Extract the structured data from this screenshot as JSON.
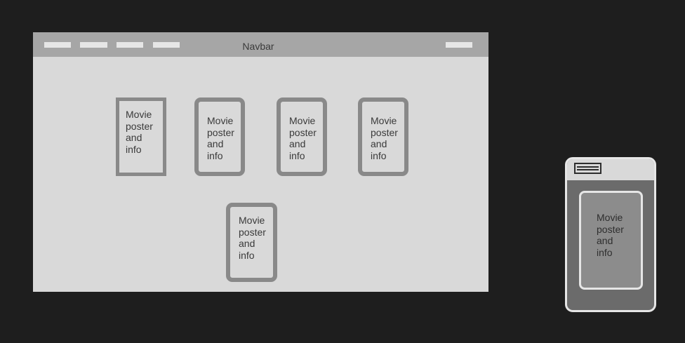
{
  "desktop": {
    "navbar": {
      "title": "Navbar",
      "menu_items": [
        "",
        "",
        "",
        ""
      ],
      "right_item": ""
    },
    "cards": [
      {
        "label": "Movie\nposter\nand\ninfo"
      },
      {
        "label": "Movie\nposter\nand\ninfo"
      },
      {
        "label": "Movie\nposter\nand\ninfo"
      },
      {
        "label": "Movie\nposter\nand\ninfo"
      },
      {
        "label": "Movie\nposter\nand\ninfo"
      }
    ]
  },
  "mobile": {
    "menu_icon": "hamburger-icon",
    "card": {
      "label": "Movie\nposter\nand\ninfo"
    }
  },
  "colors": {
    "canvas": "#1e1e1e",
    "frame": "#d9d9d9",
    "navbar": "#a6a6a6",
    "card_border": "#898989",
    "phone_body": "#6b6b6b"
  }
}
